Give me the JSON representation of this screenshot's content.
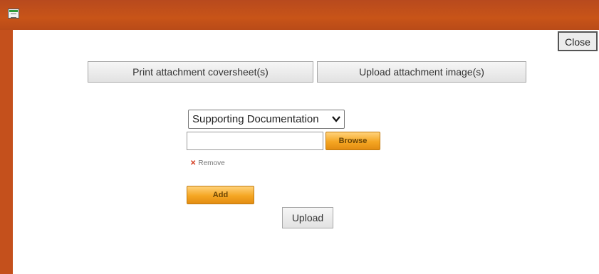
{
  "window": {
    "icon": "form-window-icon",
    "colors": {
      "frame": "#c4501c",
      "accent_orange": "#f5a623"
    }
  },
  "toolbar": {
    "close_label": "Close",
    "print_label": "Print attachment coversheet(s)",
    "upload_image_label": "Upload attachment image(s)"
  },
  "form": {
    "document_type": {
      "selected": "Supporting Documentation"
    },
    "file_input_value": "",
    "browse_label": "Browse",
    "remove_label": "Remove",
    "add_label": "Add",
    "upload_label": "Upload"
  }
}
